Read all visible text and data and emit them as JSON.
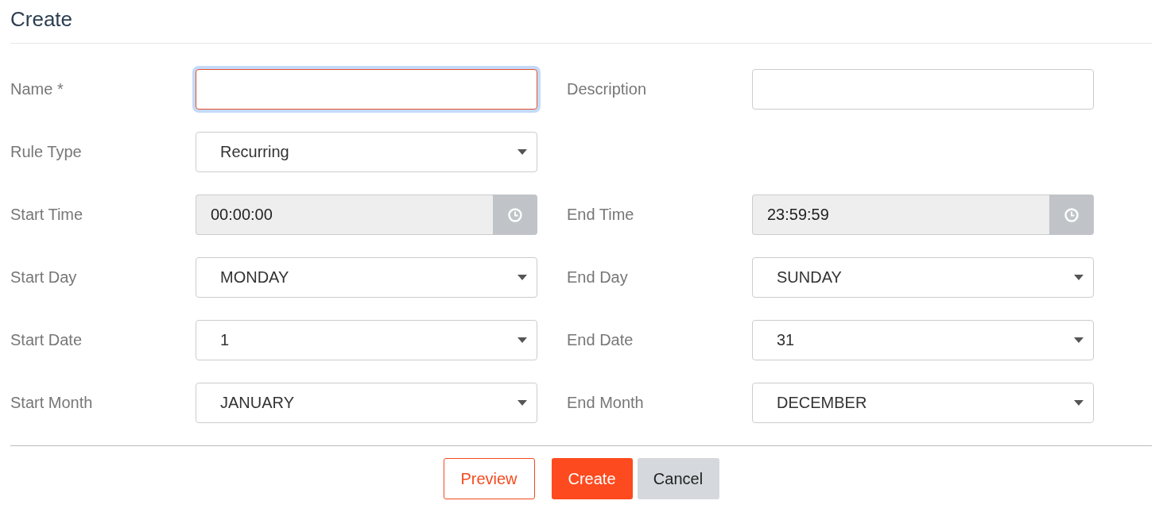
{
  "title": "Create",
  "rows": [
    {
      "fields": [
        {
          "kind": "text",
          "label": "Name *",
          "focused": true
        },
        {
          "kind": "text",
          "label": "Description",
          "focused": false
        }
      ]
    },
    {
      "fields": [
        {
          "kind": "select",
          "label": "Rule Type",
          "value": "Recurring",
          "focused": false
        }
      ]
    },
    {
      "fields": [
        {
          "kind": "time",
          "label": "Start Time",
          "value": "00:00:00",
          "focused": false
        },
        {
          "kind": "time",
          "label": "End Time",
          "value": "23:59:59",
          "focused": false
        }
      ]
    },
    {
      "fields": [
        {
          "kind": "select",
          "label": "Start Day",
          "value": "MONDAY",
          "focused": false
        },
        {
          "kind": "select",
          "label": "End Day",
          "value": "SUNDAY",
          "focused": false
        }
      ]
    },
    {
      "fields": [
        {
          "kind": "select",
          "label": "Start Date",
          "value": "1",
          "focused": false
        },
        {
          "kind": "select",
          "label": "End Date",
          "value": "31",
          "focused": false
        }
      ]
    },
    {
      "fields": [
        {
          "kind": "select",
          "label": "Start Month",
          "value": "JANUARY",
          "focused": false
        },
        {
          "kind": "select",
          "label": "End Month",
          "value": "DECEMBER",
          "focused": false
        }
      ]
    }
  ],
  "buttons": [
    {
      "kind": "outline",
      "label": "Preview"
    },
    {
      "kind": "primary",
      "label": "Create"
    },
    {
      "kind": "secondary",
      "label": "Cancel"
    }
  ]
}
